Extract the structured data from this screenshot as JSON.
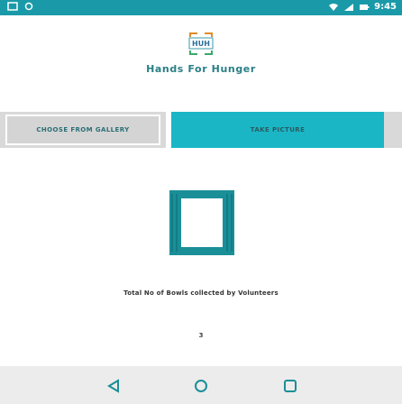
{
  "status_bar": {
    "time": "9:45",
    "left_icons": [
      "sim-icon",
      "circle-icon"
    ],
    "right_icons": [
      "wifi-icon",
      "signal-icon",
      "battery-icon"
    ],
    "background": "#1a9aa8"
  },
  "header": {
    "logo_text": "HUH",
    "title": "Hands For Hunger"
  },
  "actions": {
    "gallery_label": "Choose from gallery",
    "take_picture_label": "Take picture"
  },
  "stats": {
    "label": "Total No of Bowls collected by Volunteers",
    "value": "3"
  },
  "nav": {
    "icons": [
      "back-icon",
      "home-icon",
      "recents-icon"
    ]
  },
  "colors": {
    "accent": "#1ab6c6",
    "title": "#2a7f86",
    "preview_frame": "#167e86"
  }
}
